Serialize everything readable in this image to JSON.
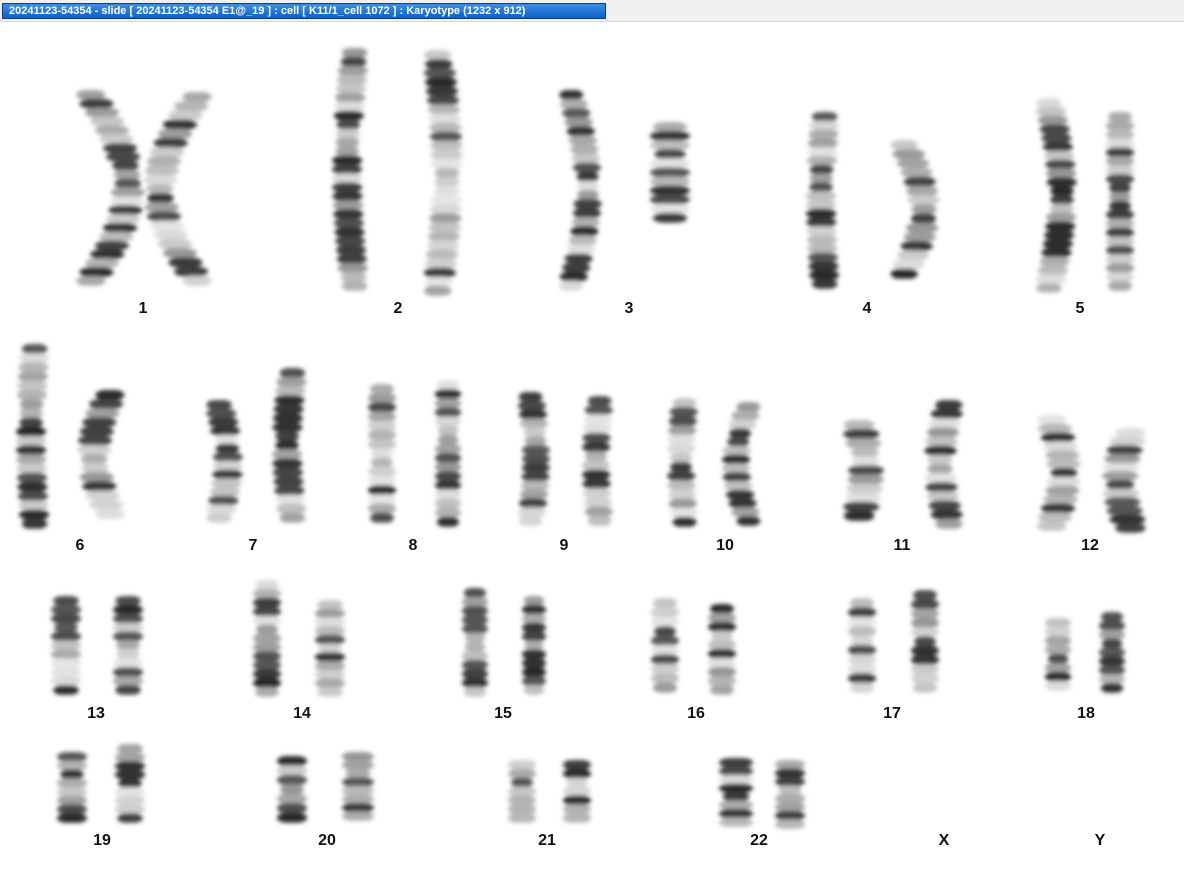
{
  "window": {
    "title": "20241123-54354 - slide [ 20241123-54354 E1@_19 ] : cell [ K11/1_cell 1072 ] : Karyotype  (1232 x 912)"
  },
  "karyotype": {
    "chromosomes": [
      {
        "label": "1"
      },
      {
        "label": "2"
      },
      {
        "label": "3"
      },
      {
        "label": "4"
      },
      {
        "label": "5"
      },
      {
        "label": "6"
      },
      {
        "label": "7"
      },
      {
        "label": "8"
      },
      {
        "label": "9"
      },
      {
        "label": "10"
      },
      {
        "label": "11"
      },
      {
        "label": "12"
      },
      {
        "label": "13"
      },
      {
        "label": "14"
      },
      {
        "label": "15"
      },
      {
        "label": "16"
      },
      {
        "label": "17"
      },
      {
        "label": "18"
      },
      {
        "label": "19"
      },
      {
        "label": "20"
      },
      {
        "label": "21"
      },
      {
        "label": "22"
      },
      {
        "label": "X"
      },
      {
        "label": "Y"
      }
    ]
  }
}
